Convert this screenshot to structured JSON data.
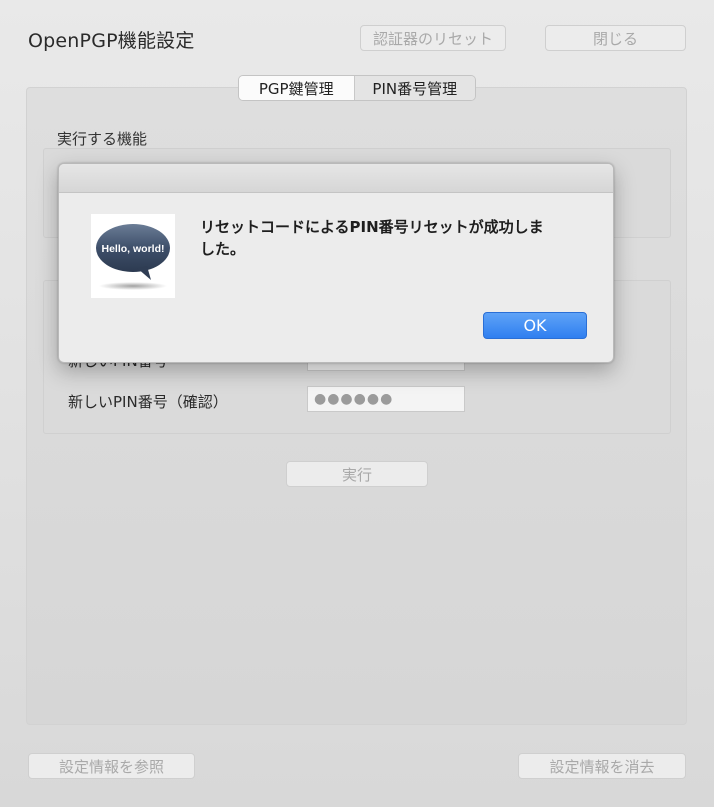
{
  "window": {
    "title": "OpenPGP機能設定",
    "reset_authenticator_label": "認証器のリセット",
    "close_label": "閉じる"
  },
  "tabs": [
    {
      "label": "PGP鍵管理",
      "selected": true
    },
    {
      "label": "PIN番号管理",
      "selected": false
    }
  ],
  "pin_panel": {
    "section_label": "実行する機能",
    "new_pin_label": "新しいPIN番号",
    "new_pin_confirm_label": "新しいPIN番号（確認）",
    "new_pin_confirm_value": "●●●●●●",
    "execute_label": "実行"
  },
  "footer": {
    "view_settings_label": "設定情報を参照",
    "clear_settings_label": "設定情報を消去"
  },
  "dialog": {
    "icon_text": "Hello, world!",
    "message_line1": "リセットコードによるPIN番号リセットが成功しま",
    "message_line2": "した。",
    "ok_label": "OK"
  },
  "colors": {
    "accent": "#2f7ff0",
    "window_bg": "#e6e6e6"
  }
}
